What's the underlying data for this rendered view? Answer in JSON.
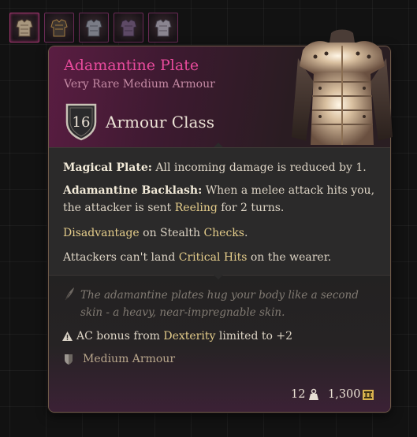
{
  "equipment_slots": [
    {
      "name": "Adamantine Plate",
      "icon": "chest-armour-icon",
      "active": true
    },
    {
      "name": "Dark armour",
      "icon": "chest-armour-icon",
      "active": false
    },
    {
      "name": "Steel armour",
      "icon": "chest-armour-icon",
      "active": false
    },
    {
      "name": "Purple armour",
      "icon": "chest-armour-icon",
      "active": false
    },
    {
      "name": "Grey armour",
      "icon": "chest-armour-icon",
      "active": false
    }
  ],
  "tooltip": {
    "title": "Adamantine Plate",
    "subtitle": "Very Rare Medium Armour",
    "armour_class": {
      "value": "16",
      "label": "Armour Class"
    },
    "effects": [
      {
        "name": "Magical Plate:",
        "text": " All incoming damage is reduced by 1."
      },
      {
        "name": "Adamantine Backlash:",
        "text": " When a melee attack hits you,",
        "text2_a": "the attacker is sent ",
        "kw": "Reeling",
        "text2_b": " for 2 turns."
      }
    ],
    "stealth": {
      "kw1": "Disadvantage",
      "mid": " on Stealth ",
      "kw2": "Checks",
      "end": "."
    },
    "crit": {
      "pre": "Attackers can't land ",
      "kw": "Critical Hits",
      "post": " on the wearer."
    },
    "flavor": "The adamantine plates hug your body like a second skin - a heavy, near-impregnable skin.",
    "dex_note": {
      "pre": "AC bonus from ",
      "kw": "Dexterity",
      "post": " limited to +2"
    },
    "category": "Medium Armour",
    "weight": "12",
    "value": "1,300"
  },
  "colors": {
    "title": "#e84a9c",
    "subtitle": "#c48aa4",
    "keyword": "#e4cc8a",
    "flavor": "#817a72",
    "border": "#6e5a48"
  }
}
